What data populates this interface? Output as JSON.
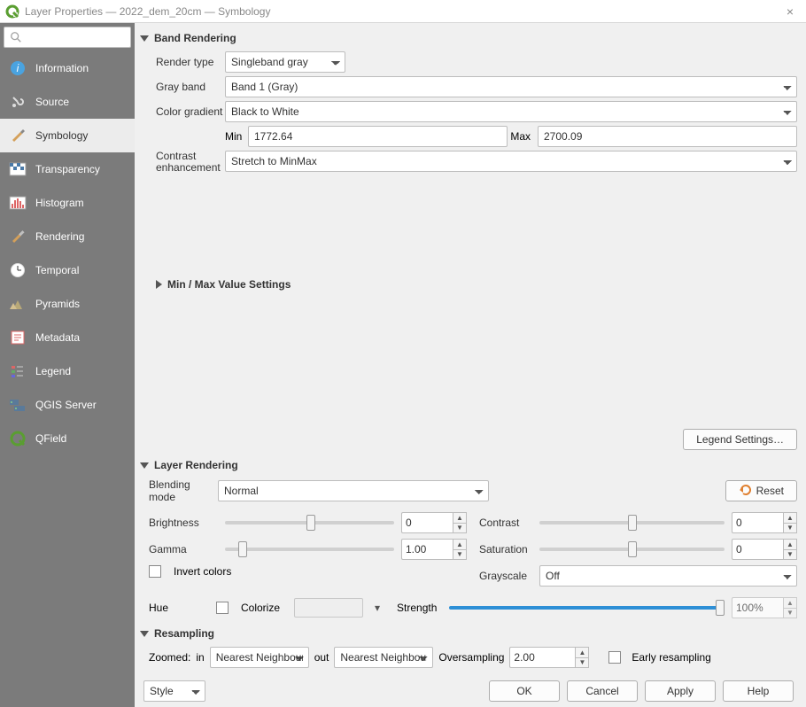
{
  "title": "Layer Properties — 2022_dem_20cm — Symbology",
  "sidebar": [
    {
      "label": "Information"
    },
    {
      "label": "Source"
    },
    {
      "label": "Symbology"
    },
    {
      "label": "Transparency"
    },
    {
      "label": "Histogram"
    },
    {
      "label": "Rendering"
    },
    {
      "label": "Temporal"
    },
    {
      "label": "Pyramids"
    },
    {
      "label": "Metadata"
    },
    {
      "label": "Legend"
    },
    {
      "label": "QGIS Server"
    },
    {
      "label": "QField"
    }
  ],
  "band_rendering": {
    "title": "Band Rendering",
    "render_type_label": "Render type",
    "render_type": "Singleband gray",
    "gray_band_label": "Gray band",
    "gray_band": "Band 1 (Gray)",
    "color_gradient_label": "Color gradient",
    "color_gradient": "Black to White",
    "min_label": "Min",
    "min_value": "1772.64",
    "max_label": "Max",
    "max_value": "2700.09",
    "contrast_label_1": "Contrast",
    "contrast_label_2": "enhancement",
    "contrast": "Stretch to MinMax",
    "minmax_title": "Min / Max Value Settings",
    "legend_settings": "Legend Settings…"
  },
  "layer_rendering": {
    "title": "Layer Rendering",
    "blending_label": "Blending mode",
    "blending": "Normal",
    "reset": "Reset",
    "brightness_label": "Brightness",
    "brightness": "0",
    "contrast_label": "Contrast",
    "contrast": "0",
    "gamma_label": "Gamma",
    "gamma": "1.00",
    "saturation_label": "Saturation",
    "saturation": "0",
    "invert_label": "Invert colors",
    "grayscale_label": "Grayscale",
    "grayscale": "Off",
    "hue_label": "Hue",
    "colorize_label": "Colorize",
    "strength_label": "Strength",
    "strength": "100%"
  },
  "resampling": {
    "title": "Resampling",
    "zoomed_label": "Zoomed:",
    "in_label": "in",
    "in_value": "Nearest Neighbour",
    "out_label": "out",
    "out_value": "Nearest Neighbour",
    "oversampling_label": "Oversampling",
    "oversampling": "2.00",
    "early_label": "Early resampling"
  },
  "buttons": {
    "style": "Style",
    "ok": "OK",
    "cancel": "Cancel",
    "apply": "Apply",
    "help": "Help"
  }
}
